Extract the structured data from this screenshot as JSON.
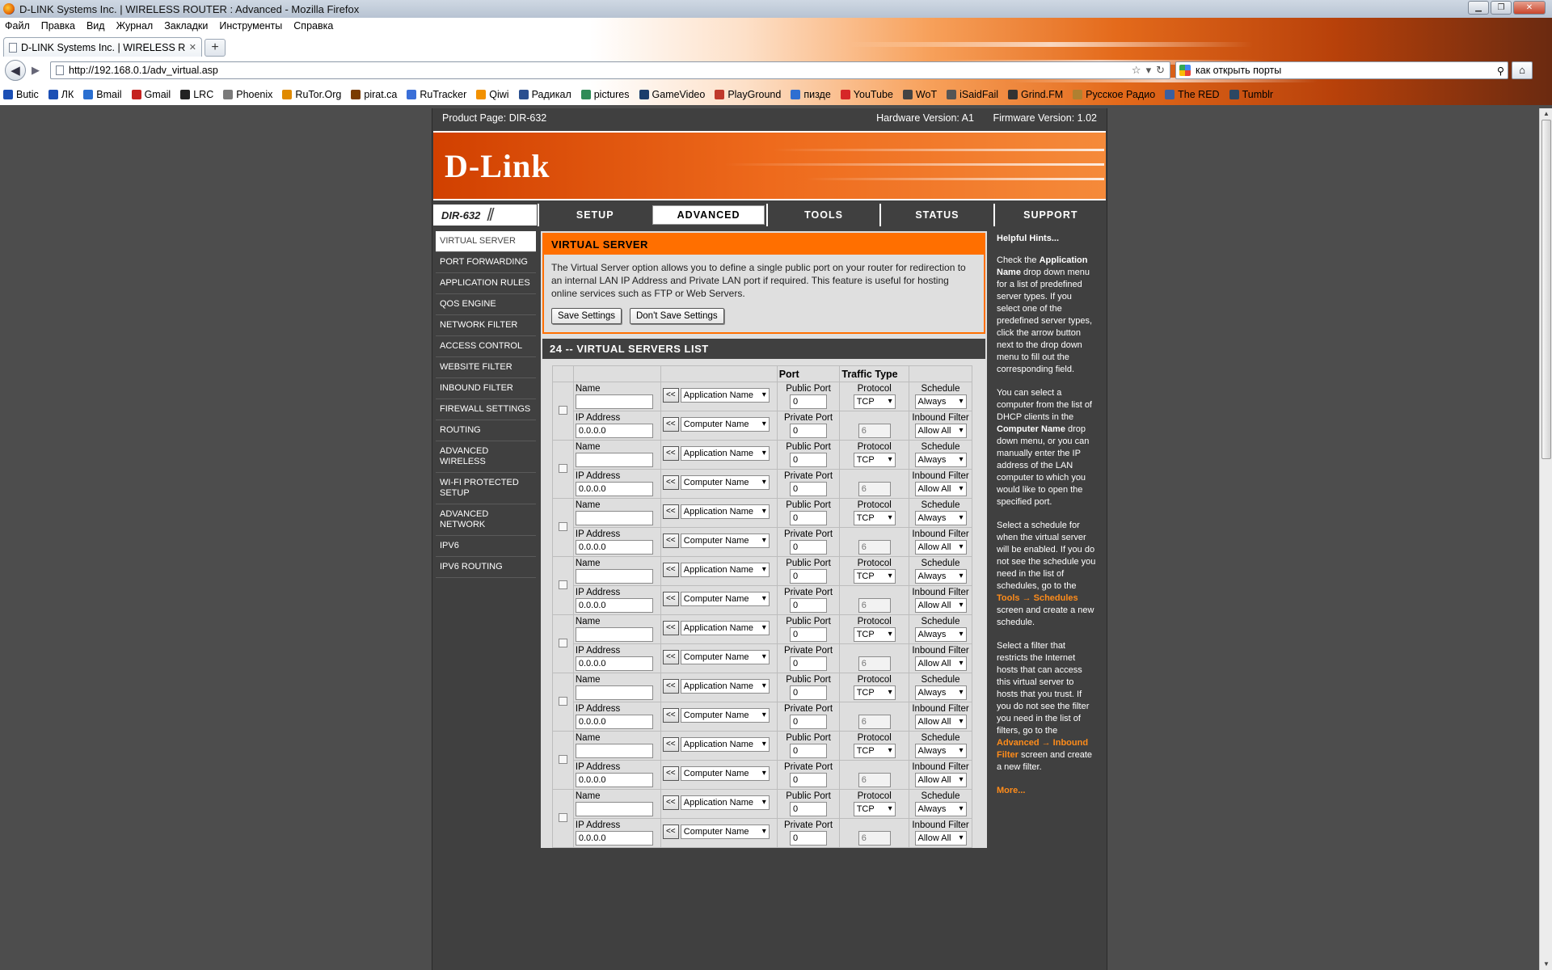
{
  "window": {
    "title": "D-LINK Systems Inc. | WIRELESS ROUTER : Advanced - Mozilla Firefox"
  },
  "menu": [
    "Файл",
    "Правка",
    "Вид",
    "Журнал",
    "Закладки",
    "Инструменты",
    "Справка"
  ],
  "tab": {
    "title": "D-LINK Systems Inc. | WIRELESS ROUTE...",
    "new_tab": "+"
  },
  "nav": {
    "url": "http://192.168.0.1/adv_virtual.asp",
    "search": "как открыть порты"
  },
  "bookmarks": [
    {
      "label": "Butic",
      "color": "#1b4fb5"
    },
    {
      "label": "ЛК",
      "color": "#1b4fb5"
    },
    {
      "label": "Bmail",
      "color": "#2a6fd0"
    },
    {
      "label": "Gmail",
      "color": "#c5221f"
    },
    {
      "label": "LRC",
      "color": "#222222"
    },
    {
      "label": "Phoenix",
      "color": "#7a7a7a"
    },
    {
      "label": "RuTor.Org",
      "color": "#e08a00"
    },
    {
      "label": "pirat.ca",
      "color": "#7a3b00"
    },
    {
      "label": "RuTracker",
      "color": "#3a6fd8"
    },
    {
      "label": "Qiwi",
      "color": "#f29100"
    },
    {
      "label": "Радикал",
      "color": "#2a4f8f"
    },
    {
      "label": "pictures",
      "color": "#2e8b57"
    },
    {
      "label": "GameVideo",
      "color": "#1a3d6b"
    },
    {
      "label": "PlayGround",
      "color": "#c0392b"
    },
    {
      "label": "пизде",
      "color": "#2f6fd1"
    },
    {
      "label": "YouTube",
      "color": "#d62728"
    },
    {
      "label": "WoT",
      "color": "#444444"
    },
    {
      "label": "iSaidFail",
      "color": "#555555"
    },
    {
      "label": "Grind.FM",
      "color": "#333333"
    },
    {
      "label": "Русское Радио",
      "color": "#b08030"
    },
    {
      "label": "The RED",
      "color": "#3b5fa0"
    },
    {
      "label": "Tumblr",
      "color": "#2c4762"
    }
  ],
  "router": {
    "product": "Product Page: DIR-632",
    "hardware": "Hardware Version: A1",
    "firmware": "Firmware Version: 1.02",
    "logo": "D-Link",
    "model": "DIR-632",
    "tabs": [
      "SETUP",
      "ADVANCED",
      "TOOLS",
      "STATUS",
      "SUPPORT"
    ],
    "active_tab": "ADVANCED",
    "sidebar": [
      "VIRTUAL SERVER",
      "PORT FORWARDING",
      "APPLICATION RULES",
      "QOS ENGINE",
      "NETWORK FILTER",
      "ACCESS CONTROL",
      "WEBSITE FILTER",
      "INBOUND FILTER",
      "FIREWALL SETTINGS",
      "ROUTING",
      "ADVANCED WIRELESS",
      "WI-FI PROTECTED SETUP",
      "ADVANCED NETWORK",
      "IPV6",
      "IPV6 ROUTING"
    ],
    "active_sidebar": "VIRTUAL SERVER",
    "vs": {
      "title": "VIRTUAL SERVER",
      "description": "The Virtual Server option allows you to define a single public port on your router for redirection to an internal LAN IP Address and Private LAN port if required. This feature is useful for hosting online services such as FTP or Web Servers.",
      "save": "Save Settings",
      "dont_save": "Don't Save Settings"
    },
    "list": {
      "title": "24 -- VIRTUAL SERVERS LIST",
      "col_port": "Port",
      "col_traffic": "Traffic Type",
      "labels": {
        "name": "Name",
        "ip": "IP Address",
        "public_port": "Public Port",
        "private_port": "Private Port",
        "protocol": "Protocol",
        "schedule": "Schedule",
        "inbound": "Inbound Filter",
        "copy_btn": "<<",
        "app_name": "Application Name",
        "computer_name": "Computer Name"
      },
      "rows": [
        {
          "name": "",
          "ip": "0.0.0.0",
          "public_port": "0",
          "private_port": "0",
          "protocol": "TCP",
          "proto_num": "6",
          "schedule": "Always",
          "inbound": "Allow All"
        },
        {
          "name": "",
          "ip": "0.0.0.0",
          "public_port": "0",
          "private_port": "0",
          "protocol": "TCP",
          "proto_num": "6",
          "schedule": "Always",
          "inbound": "Allow All"
        },
        {
          "name": "",
          "ip": "0.0.0.0",
          "public_port": "0",
          "private_port": "0",
          "protocol": "TCP",
          "proto_num": "6",
          "schedule": "Always",
          "inbound": "Allow All"
        },
        {
          "name": "",
          "ip": "0.0.0.0",
          "public_port": "0",
          "private_port": "0",
          "protocol": "TCP",
          "proto_num": "6",
          "schedule": "Always",
          "inbound": "Allow All"
        },
        {
          "name": "",
          "ip": "0.0.0.0",
          "public_port": "0",
          "private_port": "0",
          "protocol": "TCP",
          "proto_num": "6",
          "schedule": "Always",
          "inbound": "Allow All"
        },
        {
          "name": "",
          "ip": "0.0.0.0",
          "public_port": "0",
          "private_port": "0",
          "protocol": "TCP",
          "proto_num": "6",
          "schedule": "Always",
          "inbound": "Allow All"
        },
        {
          "name": "",
          "ip": "0.0.0.0",
          "public_port": "0",
          "private_port": "0",
          "protocol": "TCP",
          "proto_num": "6",
          "schedule": "Always",
          "inbound": "Allow All"
        },
        {
          "name": "",
          "ip": "0.0.0.0",
          "public_port": "0",
          "private_port": "0",
          "protocol": "TCP",
          "proto_num": "6",
          "schedule": "Always",
          "inbound": "Allow All"
        }
      ]
    },
    "hints": {
      "title": "Helpful Hints...",
      "p1_a": "Check the ",
      "p1_b": "Application Name",
      "p1_c": " drop down menu for a list of predefined server types. If you select one of the predefined server types, click the arrow button next to the drop down menu to fill out the corresponding field.",
      "p2_a": "You can select a computer from the list of DHCP clients in the ",
      "p2_b": "Computer Name",
      "p2_c": " drop down menu, or you can manually enter the IP address of the LAN computer to which you would like to open the specified port.",
      "p3_a": "Select a schedule for when the virtual server will be enabled. If you do not see the schedule you need in the list of schedules, go to the ",
      "p3_b": "Tools → Schedules",
      "p3_c": " screen and create a new schedule.",
      "p4_a": "Select a filter that restricts the Internet hosts that can access this virtual server to hosts that you trust. If you do not see the filter you need in the list of filters, go to the ",
      "p4_b": "Advanced → Inbound Filter",
      "p4_c": " screen and create a new filter.",
      "more": "More..."
    }
  }
}
